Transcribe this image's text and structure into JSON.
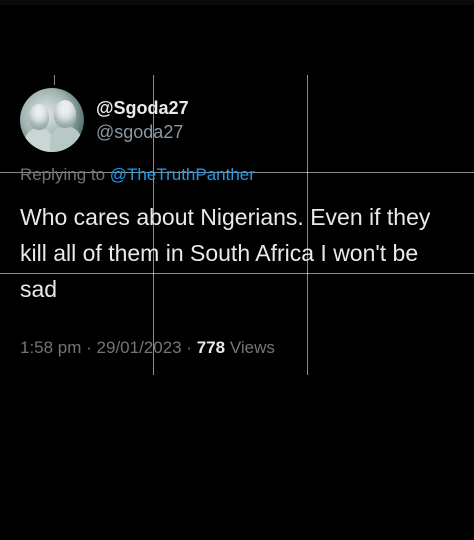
{
  "user": {
    "display_name": "@Sgoda27",
    "handle": "@sgoda27"
  },
  "reply": {
    "prefix": "Replying to ",
    "mention": "@TheTruthPanther"
  },
  "tweet": {
    "text": "Who cares about Nigerians. Even if they kill all of them in South Africa I won't be sad"
  },
  "meta": {
    "time": "1:58 pm",
    "separator": " · ",
    "date": "29/01/2023",
    "views_count": "778",
    "views_label": " Views"
  },
  "colors": {
    "background": "#000000",
    "text": "#e7e9ea",
    "muted": "#71767b",
    "link": "#1d9bf0"
  }
}
